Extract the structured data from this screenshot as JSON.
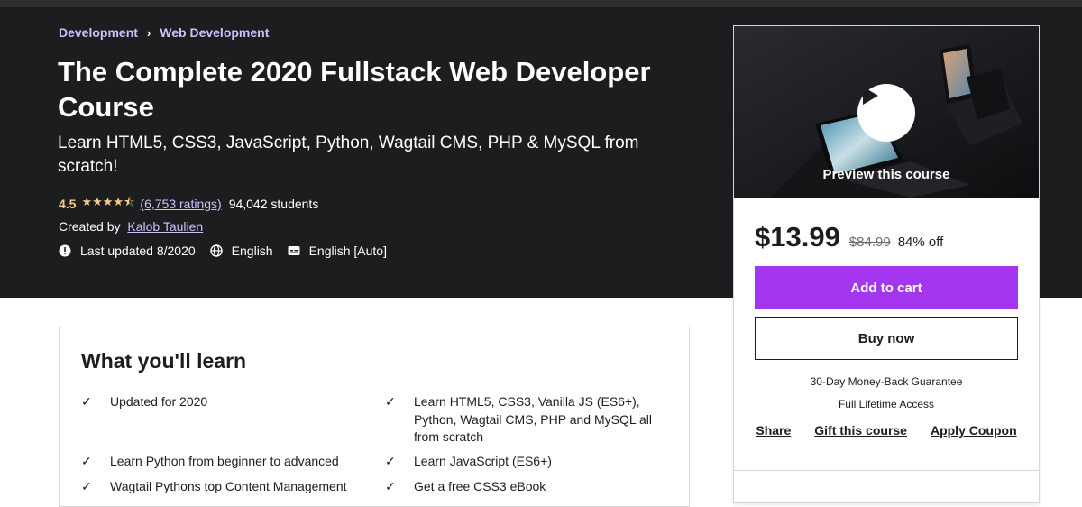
{
  "breadcrumb": {
    "items": [
      "Development",
      "Web Development"
    ],
    "separator": "›"
  },
  "course": {
    "title": "The Complete 2020 Fullstack Web Developer Course",
    "subtitle": "Learn HTML5, CSS3, JavaScript, Python, Wagtail CMS, PHP & MySQL from scratch!",
    "rating": "4.5",
    "stars": "★★★★⯪",
    "ratings_count": "(6,753 ratings)",
    "students": "94,042 students",
    "created_by_label": "Created by",
    "author": "Kalob Taulien",
    "last_updated": "Last updated 8/2020",
    "language": "English",
    "captions": "English [Auto]"
  },
  "sidebar": {
    "preview_label": "Preview this course",
    "price": "$13.99",
    "original_price": "$84.99",
    "discount": "84% off",
    "add_to_cart": "Add to cart",
    "buy_now": "Buy now",
    "guarantee": "30-Day Money-Back Guarantee",
    "lifetime": "Full Lifetime Access",
    "share": "Share",
    "gift": "Gift this course",
    "coupon": "Apply Coupon"
  },
  "learn": {
    "title": "What you'll learn",
    "items": [
      "Updated for 2020",
      "Learn HTML5, CSS3, Vanilla JS (ES6+), Python, Wagtail CMS, PHP and MySQL all from scratch",
      "Learn Python from beginner to advanced",
      "Learn JavaScript (ES6+)",
      "Wagtail Pythons top Content Management",
      "Get a free CSS3 eBook"
    ]
  },
  "colors": {
    "hero_bg": "#1c1d1f",
    "accent_purple": "#a435f0",
    "link_lavender": "#cec0fc",
    "star_gold": "#f3ca8c"
  },
  "icons": {
    "updated": "alert-badge-icon",
    "language": "globe-icon",
    "captions": "closed-captions-icon",
    "play": "play-icon",
    "check": "check-icon"
  }
}
